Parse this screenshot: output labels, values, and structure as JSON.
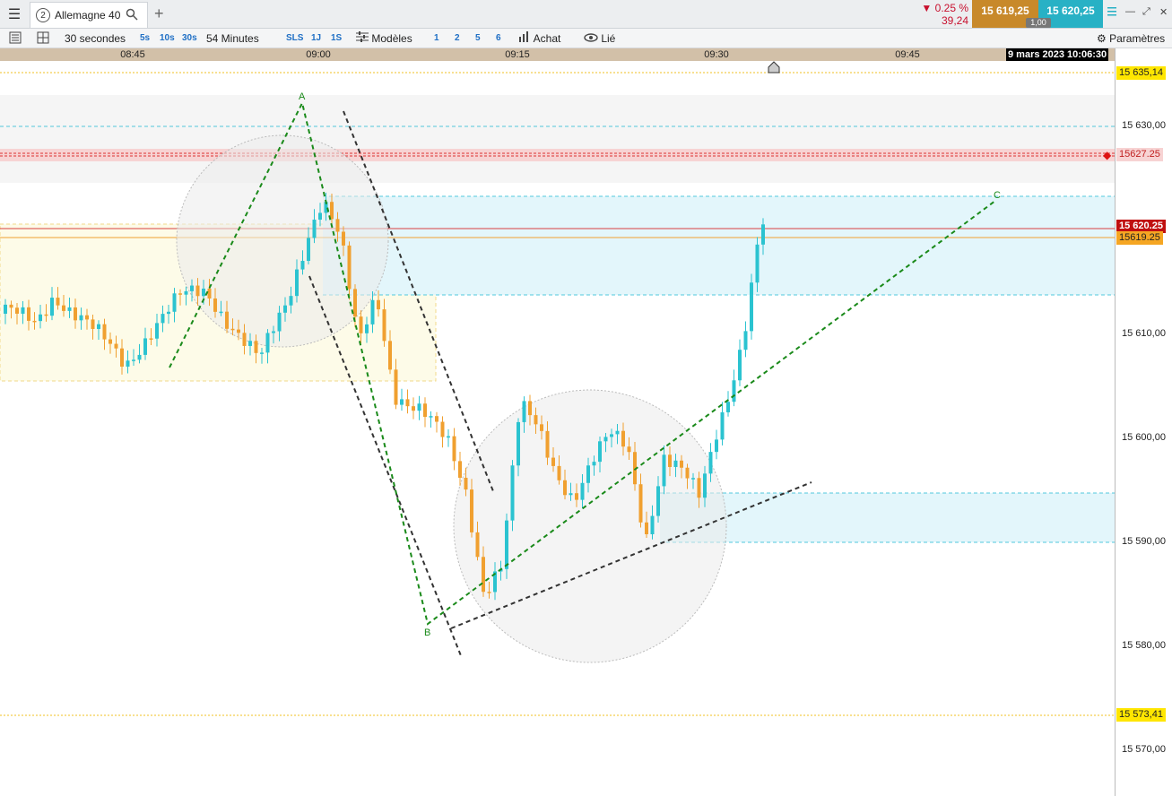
{
  "tabbar": {
    "menu_icon": "hamburger-icon",
    "tab_number": "2",
    "tab_title": "Allemagne 40",
    "search_icon": "search-icon",
    "add_tab_icon": "plus-icon",
    "change_pct": "0.25 %",
    "change_abs": "39,24",
    "bid": "15 619,25",
    "ask": "15 620,25",
    "spread": "1,00"
  },
  "toolbar": {
    "interval_value": "30 secondes",
    "q5s": "5s",
    "q10s": "10s",
    "q30s": "30s",
    "duration_value": "54 Minutes",
    "sls": "SLS",
    "q1j": "1J",
    "q1s": "1S",
    "models_label": "Modèles",
    "n1": "1",
    "n2": "2",
    "n5": "5",
    "n6": "6",
    "buy_label": "Achat",
    "linked_label": "Lié",
    "settings_label": "Paramètres"
  },
  "timeaxis": {
    "labels": [
      "08:45",
      "09:00",
      "09:15",
      "09:30",
      "09:45"
    ],
    "date_badge": "9 mars 2023 10:06:30"
  },
  "yaxis": {
    "labels": [
      "15 630,00",
      "15 610,00",
      "15 600,00",
      "15 590,00",
      "15 580,00",
      "15 570,00"
    ],
    "tag_top": "15 635,14",
    "tag_red": "15627.25",
    "tag_price": "15 620.25",
    "tag_orange": "15619.25",
    "tag_bottom": "15 573,41"
  },
  "chart": {
    "labels": {
      "A": "A",
      "B": "B",
      "C": "C"
    },
    "colors": {
      "up": "#2bc3d0",
      "down": "#f0a030",
      "pattern": "#1a8a1a",
      "channel": "#333333"
    }
  }
}
